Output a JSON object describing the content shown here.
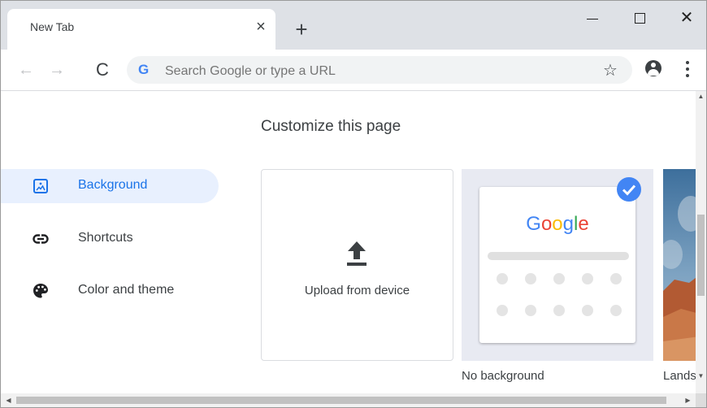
{
  "browser": {
    "tab_title": "New Tab",
    "tab_close_glyph": "×",
    "new_tab_glyph": "+",
    "window_close_glyph": "✕",
    "back_glyph": "←",
    "forward_glyph": "→",
    "reload_glyph": "C",
    "omnibox_placeholder": "Search Google or type a URL",
    "omnibox_icon_glyph": "G",
    "star_glyph": "☆",
    "icons": [
      "back-arrow-icon",
      "forward-arrow-icon",
      "reload-icon",
      "google-g-icon",
      "bookmark-star-icon",
      "profile-icon",
      "menu-dots-icon"
    ]
  },
  "dialog": {
    "title": "Customize this page",
    "sidebar": [
      {
        "label": "Background",
        "icon": "image-icon",
        "active": true
      },
      {
        "label": "Shortcuts",
        "icon": "link-icon",
        "active": false
      },
      {
        "label": "Color and theme",
        "icon": "palette-icon",
        "active": false
      }
    ],
    "tiles": {
      "upload_label": "Upload from device",
      "no_background_label": "No background",
      "no_background_selected": true,
      "landscapes_label": "Lands",
      "logo_letters": [
        "G",
        "o",
        "o",
        "g",
        "l",
        "e"
      ]
    }
  },
  "scrollbars": {
    "up_glyph": "▲",
    "down_glyph": "▼",
    "left_glyph": "◀",
    "right_glyph": "▶"
  },
  "colors": {
    "accent": "#1a73e8",
    "active_bg": "#e8f0fe",
    "check_badge": "#4285f4",
    "logo": [
      "#4285f4",
      "#ea4335",
      "#fbbc05",
      "#4285f4",
      "#34a853",
      "#ea4335"
    ]
  }
}
